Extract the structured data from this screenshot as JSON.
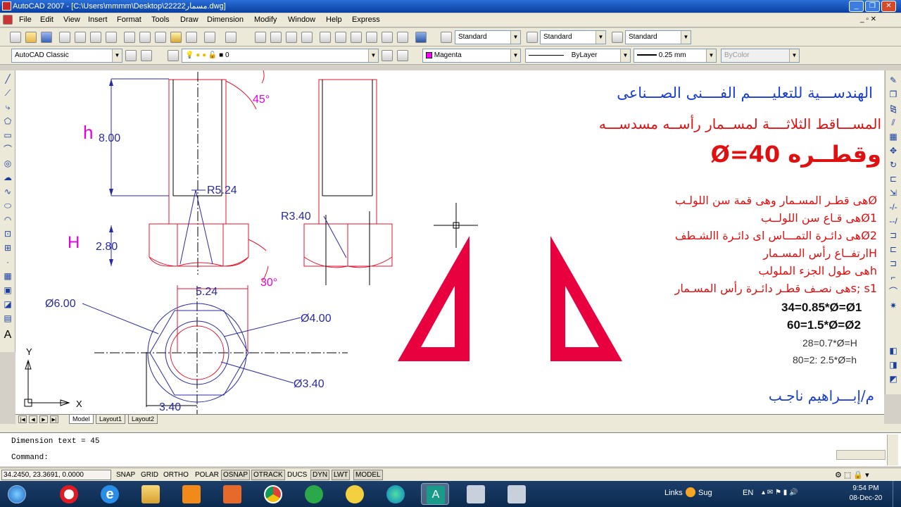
{
  "window": {
    "title": "AutoCAD 2007 - [C:\\Users\\mmmm\\Desktop\\22222مسمار.dwg]"
  },
  "menu": [
    "File",
    "Edit",
    "View",
    "Insert",
    "Format",
    "Tools",
    "Draw",
    "Dimension",
    "Modify",
    "Window",
    "Help",
    "Express"
  ],
  "styles": {
    "text_style": "Standard",
    "dim_style": "Standard",
    "table_style": "Standard"
  },
  "workspace": "AutoCAD Classic",
  "layer": {
    "name": "0"
  },
  "properties": {
    "color": "Magenta",
    "linetype": "ByLayer",
    "lineweight": "0.25 mm",
    "plotstyle": "ByColor"
  },
  "colors": {
    "magenta": "#ff00ff",
    "drawing_red": "#e0142e",
    "dim_blue": "#2a2aa0",
    "title_blue": "#1a3ed0",
    "title_red": "#e01010"
  },
  "drawing": {
    "dims": {
      "h_value": "8.00",
      "h2_value": "2.80",
      "r1": "R5.24",
      "r2": "R3.40",
      "angle1": "45°",
      "angle2": "30°",
      "w1": "5.24",
      "d6": "Ø6.00",
      "d4": "Ø4.00",
      "d34": "Ø3.40",
      "w2": "3.40"
    },
    "labels": {
      "h": "h",
      "H": "H",
      "ucs_y": "Y",
      "ucs_x": "X"
    },
    "title_lines": [
      "الهندســـية للتعليـــــم الفــــنى الصـــناعى",
      "المســـاقط الثلاثــــة لمســمار رأســه مسدســـه",
      "وقطــره Ø=40"
    ],
    "notes": [
      "Øهى قطـر المسـمار وهى قمة سن اللولـب",
      "Ø1هى قـاع سن اللولــب",
      "Ø2هى دائـرة التمـــاس اى دائـرة االشـطف",
      "Hارتفــاع رأس المسـمار",
      "hهى طول الجزء الملولب",
      "s; s1هى نصـف قطـر دائـرة رأس المسـمار"
    ],
    "formulas": [
      "34=0.85*Ø=Ø1",
      "60=1.5*Ø=Ø2",
      "28=0.7*Ø=H",
      "80=2: 2.5*Ø=h"
    ],
    "signature": "م/إبـــراهيم ناجـب"
  },
  "tabs": [
    "Model",
    "Layout1",
    "Layout2"
  ],
  "command": {
    "history": "Dimension text = 45",
    "prompt": "Command:"
  },
  "status": {
    "coords": "34.2450, 23.3691, 0.0000",
    "toggles": [
      "SNAP",
      "GRID",
      "ORTHO",
      "POLAR",
      "OSNAP",
      "OTRACK",
      "DUCS",
      "DYN",
      "LWT",
      "MODEL"
    ]
  },
  "taskbar": {
    "links": "Links",
    "search": "Sug",
    "lang": "EN",
    "time": "9:54 PM",
    "date": "08-Dec-20"
  }
}
